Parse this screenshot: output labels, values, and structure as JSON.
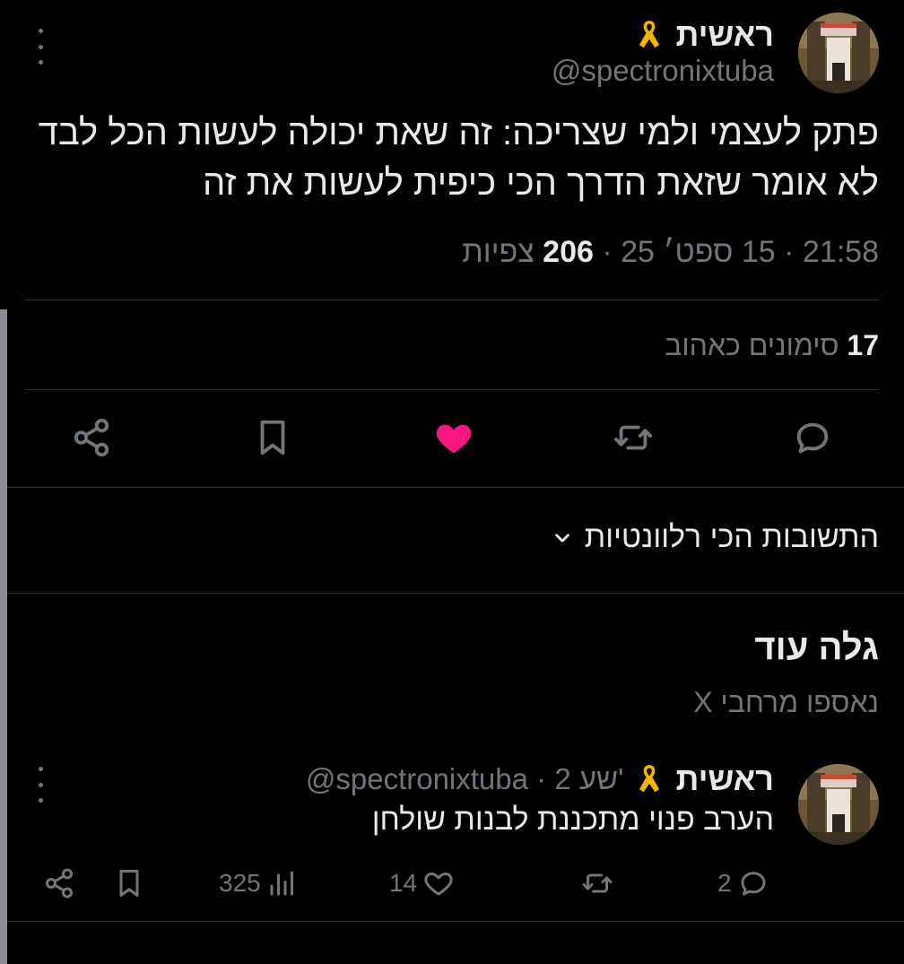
{
  "tweet": {
    "author_name": "ראשית",
    "author_handle": "@spectronixtuba",
    "text": "פתק לעצמי ולמי שצריכה: זה שאת יכולה לעשות הכל לבד לא אומר שזאת הדרך הכי כיפית לעשות את זה",
    "time": "21:58",
    "date": "15 ספט׳ 25",
    "views_count": "206",
    "views_label": "צפיות",
    "likes_count": "17",
    "likes_label": "סימונים כאהוב",
    "like_color": "#f91880"
  },
  "sort": {
    "label": "התשובות הכי רלוונטיות"
  },
  "discover": {
    "title": "גלה עוד",
    "subtitle": "נאספו מרחבי X"
  },
  "reply": {
    "author_name": "ראשית",
    "author_handle_time": "@spectronixtuba · 2 שע'",
    "text": "הערב פנוי מתכננת לבנות שולחן",
    "replies": "2",
    "likes": "14",
    "views": "325"
  },
  "icons": {
    "ribbon": "yellow-ribbon-icon",
    "more": "more-vertical-icon",
    "reply": "reply-icon",
    "repost": "repost-icon",
    "like": "heart-icon",
    "bookmark": "bookmark-icon",
    "share": "share-icon",
    "views": "views-icon",
    "chevron": "chevron-down-icon"
  }
}
